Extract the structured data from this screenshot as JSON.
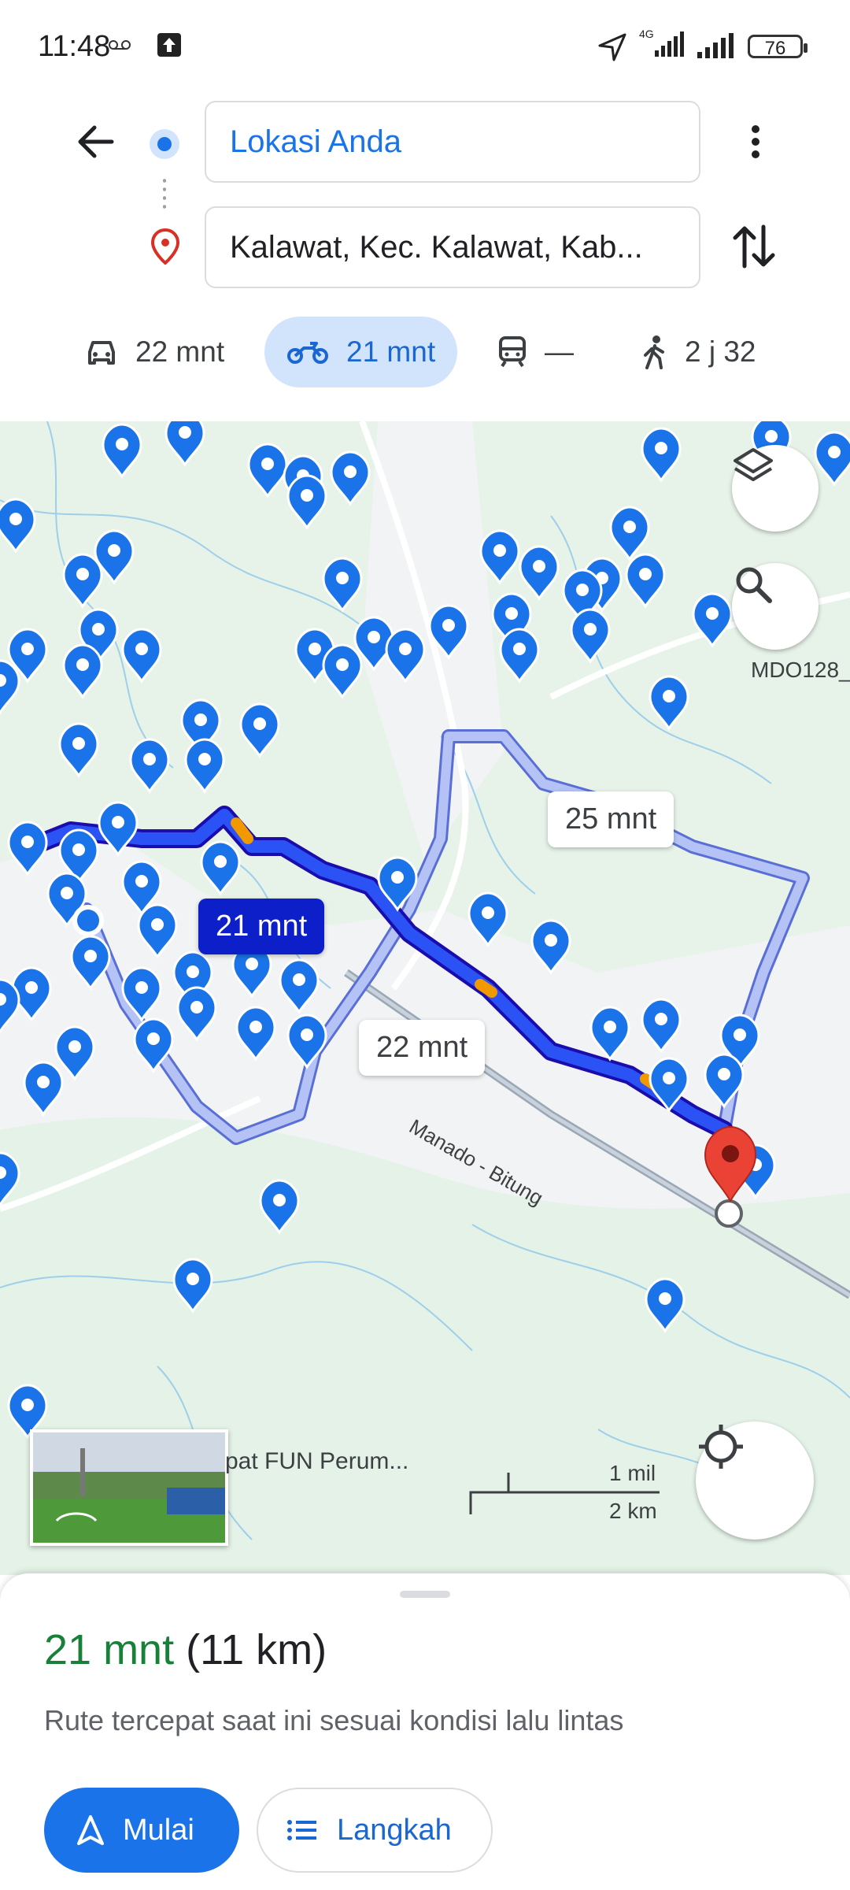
{
  "status_bar": {
    "time": "11:48",
    "network": "4G",
    "battery": "76"
  },
  "directions": {
    "origin": "Lokasi Anda",
    "destination": "Kalawat, Kec. Kalawat, Kab..."
  },
  "modes": [
    {
      "name": "car",
      "label": "22 mnt"
    },
    {
      "name": "motorcycle",
      "label": "21 mnt",
      "selected": true
    },
    {
      "name": "transit",
      "label": "—"
    },
    {
      "name": "walk",
      "label": "2 j 32"
    }
  ],
  "map": {
    "route_labels": {
      "primary": "21 mnt",
      "alt1": "25 mnt",
      "alt2": "22 mnt"
    },
    "place_label": "MDO128_",
    "road_label": "Manado - Bitung",
    "thumbnail_caption": "pat FUN Perum...",
    "scale": {
      "imperial": "1 mil",
      "metric": "2 km"
    }
  },
  "sheet": {
    "duration": "21 mnt",
    "distance": "(11 km)",
    "description": "Rute tercepat saat ini sesuai kondisi lalu lintas",
    "start_label": "Mulai",
    "steps_label": "Langkah"
  },
  "colors": {
    "accent": "#1a73e8",
    "route_primary": "#0d1fc9",
    "route_alt": "#a8b8f0",
    "duration": "#188038",
    "map_bg": "#e7f3e9",
    "pin": "#1a73e8",
    "dest_pin": "#ea4335"
  }
}
